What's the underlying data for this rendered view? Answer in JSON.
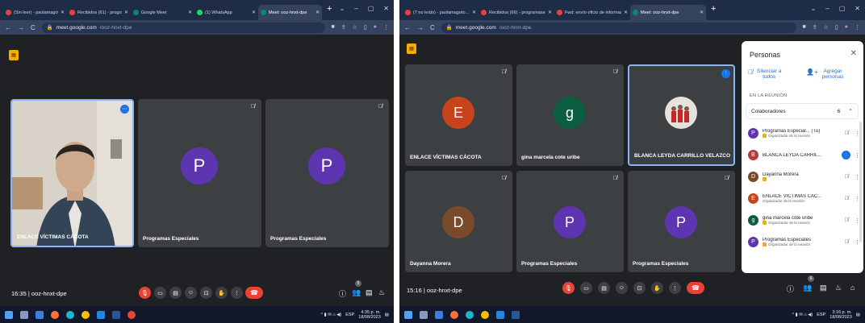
{
  "left": {
    "tabs": [
      {
        "label": "(Sin leer) - paolamagoto...",
        "color": "#ea4335",
        "active": false
      },
      {
        "label": "Recibidos (61) - programase...",
        "color": "#ea4335",
        "active": false
      },
      {
        "label": "Google Meet",
        "color": "#00897b",
        "active": false
      },
      {
        "label": "(1) WhatsApp",
        "color": "#25d366",
        "active": false
      },
      {
        "label": "Meet: ooz-hnxt-dpe",
        "color": "#00897b",
        "active": true
      }
    ],
    "url_host": "meet.google.com",
    "url_path": "/ooz-hnxt-dpe",
    "tiles": [
      {
        "name": "ENLACE VÍCTIMAS CÁCOTA",
        "type": "video"
      },
      {
        "name": "Programas Especiales",
        "initial": "P",
        "color": "#5e35b1"
      },
      {
        "name": "Programas Especiales",
        "initial": "P",
        "color": "#5e35b1"
      }
    ],
    "time": "16:35",
    "meeting_code": "ooz-hnxt-dpe",
    "participant_count": "5",
    "clock_time": "4:35 p. m.",
    "clock_date": "18/08/2023",
    "lang": "ESP"
  },
  "right": {
    "tabs": [
      {
        "label": "(7 no leído) - paolamagoto...",
        "color": "#ea4335",
        "active": false
      },
      {
        "label": "Recibidos (66) - programasesp...",
        "color": "#ea4335",
        "active": false
      },
      {
        "label": "Fwd: envío oficio de informació...",
        "color": "#ea4335",
        "active": false
      },
      {
        "label": "Meet: ooz-hnxt-dpe",
        "color": "#00897b",
        "active": true
      }
    ],
    "url_host": "meet.google.com",
    "url_path": "/ooz-hnxt-dpe",
    "tiles": [
      {
        "name": "ENLACE VÍCTIMAS CÁCOTA",
        "initial": "E",
        "color": "#c5441c"
      },
      {
        "name": "gina marcela cote uribe",
        "initial": "g",
        "color": "#0b5e3f"
      },
      {
        "name": "BLANCA LEYDA CARRILLO VELAZCO",
        "type": "photo"
      },
      {
        "name": "Dayanna Morera",
        "initial": "D",
        "color": "#7a4a2a"
      },
      {
        "name": "Programas Especiales",
        "initial": "P",
        "color": "#5e35b1"
      },
      {
        "name": "Programas Especiales",
        "initial": "P",
        "color": "#5e35b1"
      }
    ],
    "time": "15:16",
    "meeting_code": "ooz-hnxt-dpe",
    "participant_count": "6",
    "clock_time": "3:16 p. m.",
    "clock_date": "18/08/2023",
    "lang": "ESP",
    "panel": {
      "title": "Personas",
      "mute_all": "Silenciar a todos",
      "mute_all_1": "Silenciar a",
      "mute_all_2": "todos",
      "add_1": "Agregar",
      "add_2": "personas",
      "section": "EN LA REUNIÓN",
      "group": "Colaboradores",
      "group_count": "6",
      "people": [
        {
          "name": "Programas Especial... (Tú)",
          "role": "Organizador de la reunión",
          "initial": "P",
          "color": "#5e35b1",
          "badge": true
        },
        {
          "name": "BLANCA LEYDA CARRIL...",
          "role": "",
          "initial": "B",
          "color": "#b23c3c",
          "speaking": true
        },
        {
          "name": "Dayanna Morera",
          "role": "",
          "initial": "D",
          "color": "#7a4a2a",
          "badge": true
        },
        {
          "name": "ENLACE VÍCTIMAS CÁC...",
          "role": "Organizador de la reunión",
          "initial": "E",
          "color": "#c5441c",
          "badge": false
        },
        {
          "name": "gina marcela cote uribe",
          "role": "Organizador de la reunión",
          "initial": "g",
          "color": "#0b5e3f",
          "badge": true
        },
        {
          "name": "Programas Especiales",
          "role": "Organizador de la reunión",
          "initial": "P",
          "color": "#5e35b1",
          "badge": true
        }
      ]
    }
  }
}
